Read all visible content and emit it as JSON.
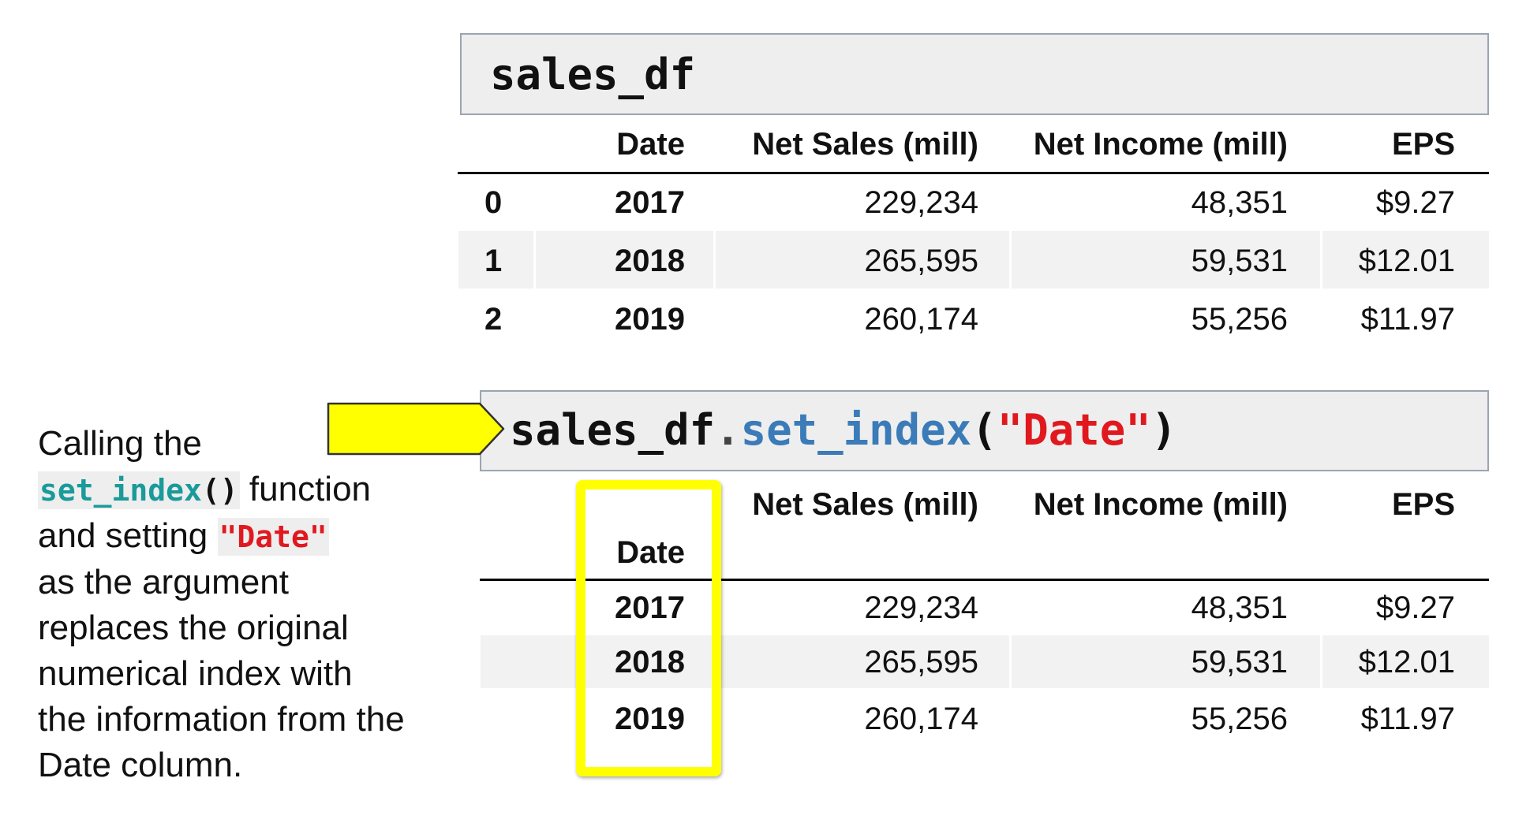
{
  "top_cell": {
    "code": "sales_df"
  },
  "bottom_cell": {
    "code_obj": "sales_df",
    "code_dot": ".",
    "code_fn": "set_index",
    "code_open": "(",
    "code_str": "\"Date\"",
    "code_close": ")"
  },
  "table1": {
    "headers": [
      "",
      "Date",
      "Net Sales (mill)",
      "Net Income (mill)",
      "EPS"
    ],
    "rows": [
      {
        "index": "0",
        "date": "2017",
        "net_sales": "229,234",
        "net_income": "48,351",
        "eps": "$9.27"
      },
      {
        "index": "1",
        "date": "2018",
        "net_sales": "265,595",
        "net_income": "59,531",
        "eps": "$12.01"
      },
      {
        "index": "2",
        "date": "2019",
        "net_sales": "260,174",
        "net_income": "55,256",
        "eps": "$11.97"
      }
    ]
  },
  "table2": {
    "headers": [
      "Net Sales (mill)",
      "Net Income (mill)",
      "EPS"
    ],
    "index_name": "Date",
    "rows": [
      {
        "date": "2017",
        "net_sales": "229,234",
        "net_income": "48,351",
        "eps": "$9.27"
      },
      {
        "date": "2018",
        "net_sales": "265,595",
        "net_income": "59,531",
        "eps": "$12.01"
      },
      {
        "date": "2019",
        "net_sales": "260,174",
        "net_income": "55,256",
        "eps": "$11.97"
      }
    ]
  },
  "caption": {
    "line1": "Calling the",
    "fn_name": "set_index",
    "fn_parens": "()",
    "line2_rest": " function",
    "line3_pre": "and setting ",
    "arg": "\"Date\"",
    "line4": "as the argument replaces the original numerical index with the information from the Date column."
  },
  "colors": {
    "highlight": "#ffff00",
    "function_blue": "#3a7bb8",
    "string_red": "#e0191f",
    "inline_function_teal": "#1a9a9a",
    "code_bg": "#eeeeee",
    "stripe_bg": "#f2f2f2"
  },
  "icons": {
    "arrow": "yellow-arrow-icon"
  }
}
